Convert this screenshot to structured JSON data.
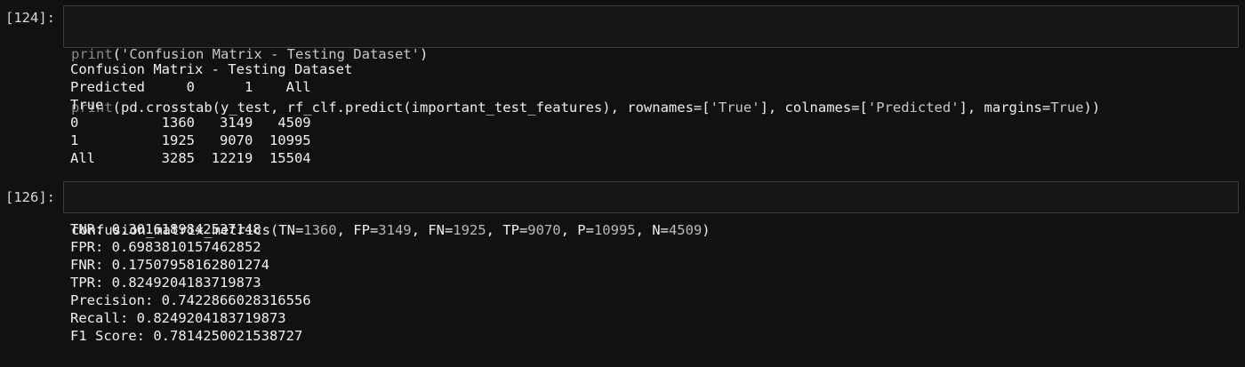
{
  "cells": [
    {
      "prompt": "[124]:",
      "code": {
        "line1": [
          {
            "t": "print",
            "c": "kw-print"
          },
          {
            "t": "(",
            "c": "plain"
          },
          {
            "t": "'Confusion Matrix - Testing Dataset'",
            "c": "str"
          },
          {
            "t": ")",
            "c": "plain"
          }
        ],
        "line2": [
          {
            "t": "print",
            "c": "kw-print"
          },
          {
            "t": "(pd.crosstab(y_test, rf_clf.predict(important_test_features), rownames=[",
            "c": "plain"
          },
          {
            "t": "'True'",
            "c": "str"
          },
          {
            "t": "], colnames=[",
            "c": "plain"
          },
          {
            "t": "'Predicted'",
            "c": "str"
          },
          {
            "t": "], margins=",
            "c": "plain"
          },
          {
            "t": "True",
            "c": "const"
          },
          {
            "t": "))",
            "c": "plain"
          }
        ]
      },
      "output": [
        "Confusion Matrix - Testing Dataset",
        "Predicted     0      1    All",
        "True",
        "0          1360   3149   4509",
        "1          1925   9070  10995",
        "All        3285  12219  15504"
      ]
    },
    {
      "prompt": "[126]:",
      "code": {
        "line1": [
          {
            "t": "confusion_matrix_metrics(TN=",
            "c": "plain"
          },
          {
            "t": "1360",
            "c": "num"
          },
          {
            "t": ", FP=",
            "c": "plain"
          },
          {
            "t": "3149",
            "c": "num"
          },
          {
            "t": ", FN=",
            "c": "plain"
          },
          {
            "t": "1925",
            "c": "num"
          },
          {
            "t": ", TP=",
            "c": "plain"
          },
          {
            "t": "9070",
            "c": "num"
          },
          {
            "t": ", P=",
            "c": "plain"
          },
          {
            "t": "10995",
            "c": "num"
          },
          {
            "t": ", N=",
            "c": "plain"
          },
          {
            "t": "4509",
            "c": "num"
          },
          {
            "t": ")",
            "c": "plain"
          }
        ]
      },
      "output": [
        "TNR: 0.3016189842537148",
        "FPR: 0.6983810157462852",
        "FNR: 0.17507958162801274",
        "TPR: 0.8249204183719873",
        "Precision: 0.7422866028316556",
        "Recall: 0.8249204183719873",
        "F1 Score: 0.7814250021538727"
      ]
    }
  ],
  "colors": {
    "background": "#111111",
    "cell_border": "#3d3d3d",
    "text": "#ededed",
    "muted": "#8a8a8a"
  }
}
